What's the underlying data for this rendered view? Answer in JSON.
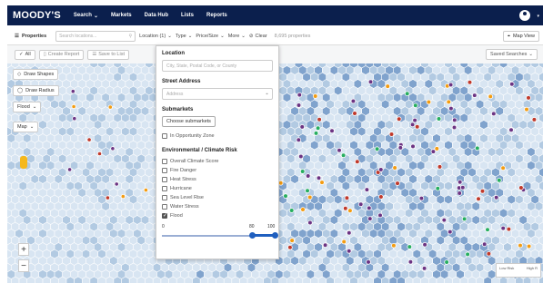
{
  "topnav": {
    "logo": "MOODY'S",
    "items": [
      "Search",
      "Markets",
      "Data Hub",
      "Lists",
      "Reports"
    ],
    "search_caret": "⌄"
  },
  "toolbar": {
    "properties_label": "Properties",
    "search_placeholder": "Search locations...",
    "location_label": "Location (1)",
    "type_label": "Type",
    "price_size_label": "Price/Size",
    "more_label": "More",
    "clear_label": "Clear",
    "count_text": "8,695 properties",
    "map_view_label": "Map View"
  },
  "subbar": {
    "all_label": "All",
    "create_report_label": "Create Report",
    "save_to_list_label": "Save to List",
    "saved_searches_label": "Saved Searches"
  },
  "map": {
    "draw_shapes_label": "Draw Shapes",
    "draw_radius_label": "Draw Radius",
    "flood_label": "Flood",
    "map_type_label": "Map",
    "zoom_in": "+",
    "zoom_out": "−",
    "legend_low": "Low Risk",
    "legend_high": "High R",
    "colors": {
      "hex_light": "#d6e4f2",
      "hex_mid": "#a9c4e0",
      "hex_dark": "#6f97c7",
      "pin_red": "#c0392b",
      "pin_purple": "#6c3483",
      "pin_orange": "#f39c12",
      "pin_green": "#27ae60"
    }
  },
  "panel": {
    "location_heading": "Location",
    "location_placeholder": "City, State, Postal Code, or County",
    "street_heading": "Street Address",
    "street_placeholder": "Address",
    "submarkets_heading": "Submarkets",
    "choose_submarkets_label": "Choose submarkets",
    "opportunity_zone_label": "In Opportunity Zone",
    "env_heading": "Environmental / Climate Risk",
    "risks": [
      {
        "label": "Overall Climate Score",
        "checked": false
      },
      {
        "label": "Fire Danger",
        "checked": false
      },
      {
        "label": "Heat Stress",
        "checked": false
      },
      {
        "label": "Hurricane",
        "checked": false
      },
      {
        "label": "Sea Level Rise",
        "checked": false
      },
      {
        "label": "Water Stress",
        "checked": false
      },
      {
        "label": "Flood",
        "checked": true
      }
    ],
    "range_min": "0",
    "range_low": "80",
    "range_high": "100",
    "range_values": [
      80,
      100
    ],
    "range_max": 100,
    "accent": "#1f5fbf"
  }
}
